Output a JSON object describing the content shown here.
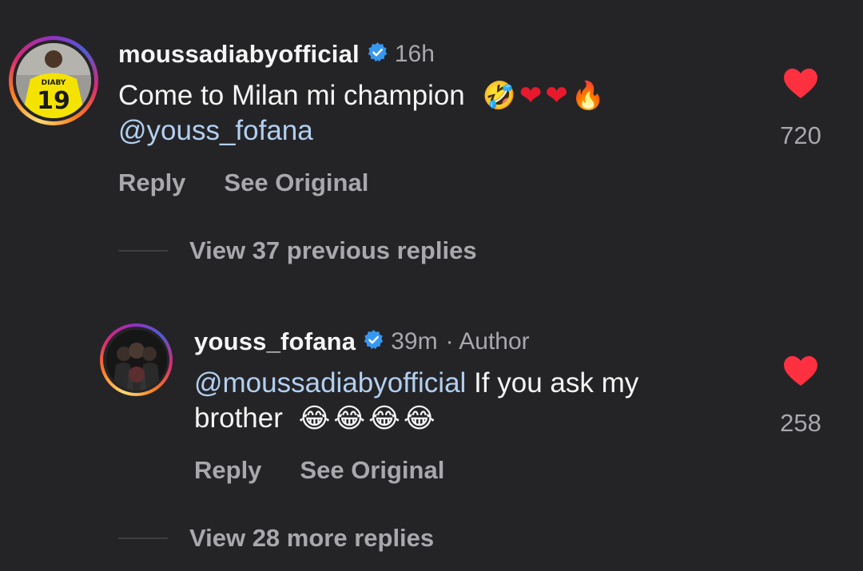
{
  "colors": {
    "background": "#242427",
    "primary_text": "#f5f5f5",
    "secondary_text": "#a8a8ad",
    "mention": "#b3cff0",
    "like_heart": "#ff3040",
    "verified_badge": "#3797f0"
  },
  "comments": [
    {
      "username": "moussadiabyofficial",
      "verified": true,
      "time": "16h",
      "text": "Come to Milan mi champion",
      "emojis": [
        "rolling-on-floor-laughing",
        "red-heart",
        "red-heart",
        "fire"
      ],
      "mention": "@youss_fofana",
      "likes": "720",
      "liked": true,
      "reply_label": "Reply",
      "see_original_label": "See Original"
    },
    {
      "username": "youss_fofana",
      "verified": true,
      "time": "39m",
      "tag": "· Author",
      "mention": "@moussadiabyofficial",
      "text_after_mention": "If you ask my",
      "text_line2": "brother",
      "emojis": [
        "face-with-tears-of-joy",
        "face-with-tears-of-joy",
        "face-with-tears-of-joy",
        "face-with-tears-of-joy"
      ],
      "likes": "258",
      "liked": true,
      "reply_label": "Reply",
      "see_original_label": "See Original"
    }
  ],
  "thread_links": {
    "previous_replies": "View 37 previous replies",
    "more_replies": "View 28 more replies"
  }
}
